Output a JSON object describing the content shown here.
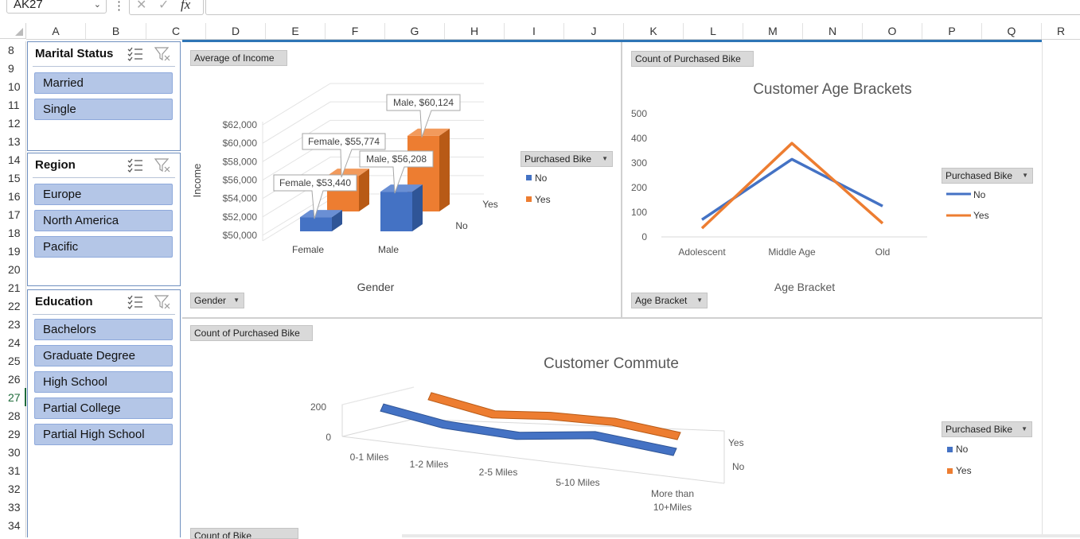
{
  "formula_bar": {
    "name_box": "AK27",
    "fx": "fx"
  },
  "columns": [
    "A",
    "B",
    "C",
    "D",
    "E",
    "F",
    "G",
    "H",
    "I",
    "J",
    "K",
    "L",
    "M",
    "N",
    "O",
    "P",
    "Q",
    "R"
  ],
  "rows": [
    "8",
    "9",
    "10",
    "11",
    "12",
    "13",
    "14",
    "15",
    "16",
    "17",
    "18",
    "19",
    "20",
    "21",
    "22",
    "23",
    "24",
    "25",
    "26",
    "27",
    "28",
    "29",
    "30",
    "31",
    "32",
    "33",
    "34"
  ],
  "selected_row": "27",
  "slicers": {
    "marital": {
      "title": "Marital Status",
      "items": [
        "Married",
        "Single"
      ]
    },
    "region": {
      "title": "Region",
      "items": [
        "Europe",
        "North America",
        "Pacific"
      ]
    },
    "education": {
      "title": "Education",
      "items": [
        "Bachelors",
        "Graduate Degree",
        "High School",
        "Partial College",
        "Partial High School"
      ]
    }
  },
  "income_chart": {
    "value_button": "Average of Income",
    "axis_button": "Gender",
    "legend_button": "Purchased Bike",
    "ylabel": "Income",
    "xlabel": "Gender",
    "ytick_labels": [
      "$50,000",
      "$52,000",
      "$54,000",
      "$56,000",
      "$58,000",
      "$60,000",
      "$62,000"
    ],
    "categories": [
      "Female",
      "Male"
    ],
    "depth_labels": [
      "No",
      "Yes"
    ],
    "legend": [
      "No",
      "Yes"
    ],
    "data_labels": [
      "Female, $53,440",
      "Female, $55,774",
      "Male, $56,208",
      "Male, $60,124"
    ]
  },
  "age_chart": {
    "value_button": "Count of Purchased Bike",
    "axis_button": "Age Bracket",
    "legend_button": "Purchased Bike",
    "title": "Customer Age Brackets",
    "xlabel": "Age Bracket",
    "ytick_labels": [
      "0",
      "100",
      "200",
      "300",
      "400",
      "500"
    ],
    "categories": [
      "Adolescent",
      "Middle Age",
      "Old"
    ],
    "legend": [
      "No",
      "Yes"
    ]
  },
  "commute_chart": {
    "value_button": "Count of Purchased Bike",
    "legend_button": "Purchased Bike",
    "title": "Customer Commute",
    "ytick_labels": [
      "0",
      "200"
    ],
    "categories": [
      "0-1 Miles",
      "1-2 Miles",
      "2-5 Miles",
      "5-10 Miles",
      "More than",
      "10+Miles"
    ],
    "depth_labels": [
      "Yes",
      "No"
    ],
    "legend": [
      "No",
      "Yes"
    ],
    "bottom_button": "Count of Bike"
  },
  "chart_data": [
    {
      "type": "bar",
      "title": "",
      "xlabel": "Gender",
      "ylabel": "Income",
      "categories": [
        "Female",
        "Male"
      ],
      "series": [
        {
          "name": "No",
          "values": [
            53440,
            56208
          ]
        },
        {
          "name": "Yes",
          "values": [
            55774,
            60124
          ]
        }
      ],
      "ylim": [
        50000,
        62000
      ],
      "legend": "right"
    },
    {
      "type": "line",
      "title": "Customer Age Brackets",
      "xlabel": "Age Bracket",
      "ylabel": "",
      "categories": [
        "Adolescent",
        "Middle Age",
        "Old"
      ],
      "series": [
        {
          "name": "No",
          "values": [
            70,
            315,
            125
          ]
        },
        {
          "name": "Yes",
          "values": [
            35,
            380,
            55
          ]
        }
      ],
      "ylim": [
        0,
        500
      ],
      "legend": "right"
    },
    {
      "type": "line",
      "title": "Customer Commute",
      "xlabel": "",
      "ylabel": "",
      "categories": [
        "0-1 Miles",
        "1-2 Miles",
        "2-5 Miles",
        "5-10 Miles",
        "More than 10+Miles"
      ],
      "series": [
        {
          "name": "No",
          "values": [
            165,
            85,
            55,
            75,
            25
          ]
        },
        {
          "name": "Yes",
          "values": [
            200,
            140,
            145,
            110,
            55
          ]
        }
      ],
      "ylim": [
        0,
        200
      ],
      "legend": "right"
    }
  ],
  "colors": {
    "no": "#4472c4",
    "yes": "#ed7d31",
    "slicer_item": "#b4c6e7",
    "chart_border": "#2e75b6"
  }
}
